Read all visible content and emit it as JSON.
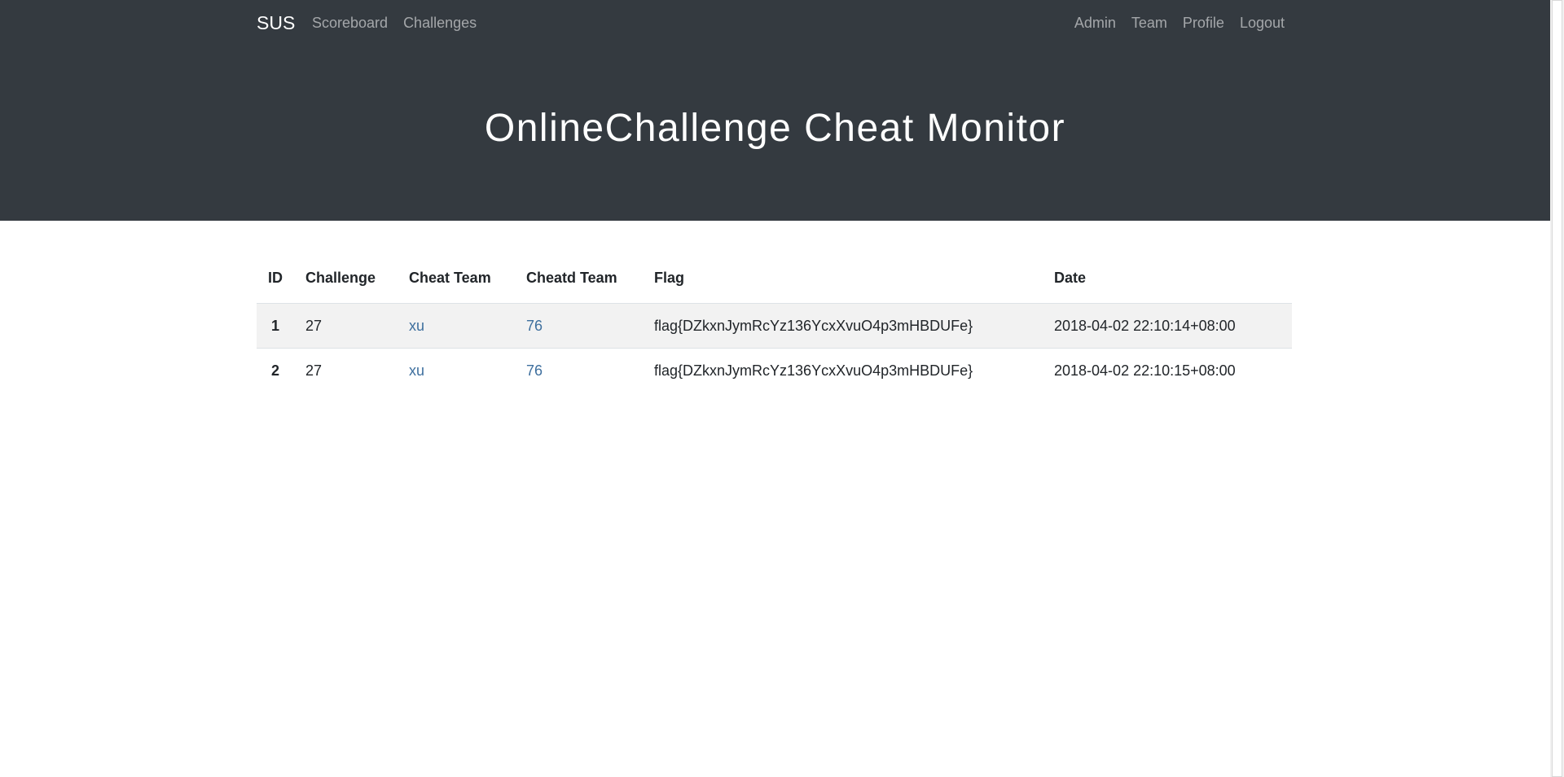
{
  "nav": {
    "brand": "SUS",
    "left": [
      {
        "label": "Scoreboard"
      },
      {
        "label": "Challenges"
      }
    ],
    "right": [
      {
        "label": "Admin"
      },
      {
        "label": "Team"
      },
      {
        "label": "Profile"
      },
      {
        "label": "Logout"
      }
    ]
  },
  "header": {
    "title": "OnlineChallenge Cheat Monitor"
  },
  "table": {
    "columns": [
      "ID",
      "Challenge",
      "Cheat Team",
      "Cheatd Team",
      "Flag",
      "Date"
    ],
    "rows": [
      {
        "id": "1",
        "challenge": "27",
        "cheat_team": "xu",
        "cheated_team": "76",
        "flag": "flag{DZkxnJymRcYz136YcxXvuO4p3mHBDUFe}",
        "date": "2018-04-02 22:10:14+08:00"
      },
      {
        "id": "2",
        "challenge": "27",
        "cheat_team": "xu",
        "cheated_team": "76",
        "flag": "flag{DZkxnJymRcYz136YcxXvuO4p3mHBDUFe}",
        "date": "2018-04-02 22:10:15+08:00"
      }
    ]
  },
  "colors": {
    "header_bg": "#343a40",
    "link": "#3e6f9e",
    "stripe": "#f2f2f2"
  }
}
